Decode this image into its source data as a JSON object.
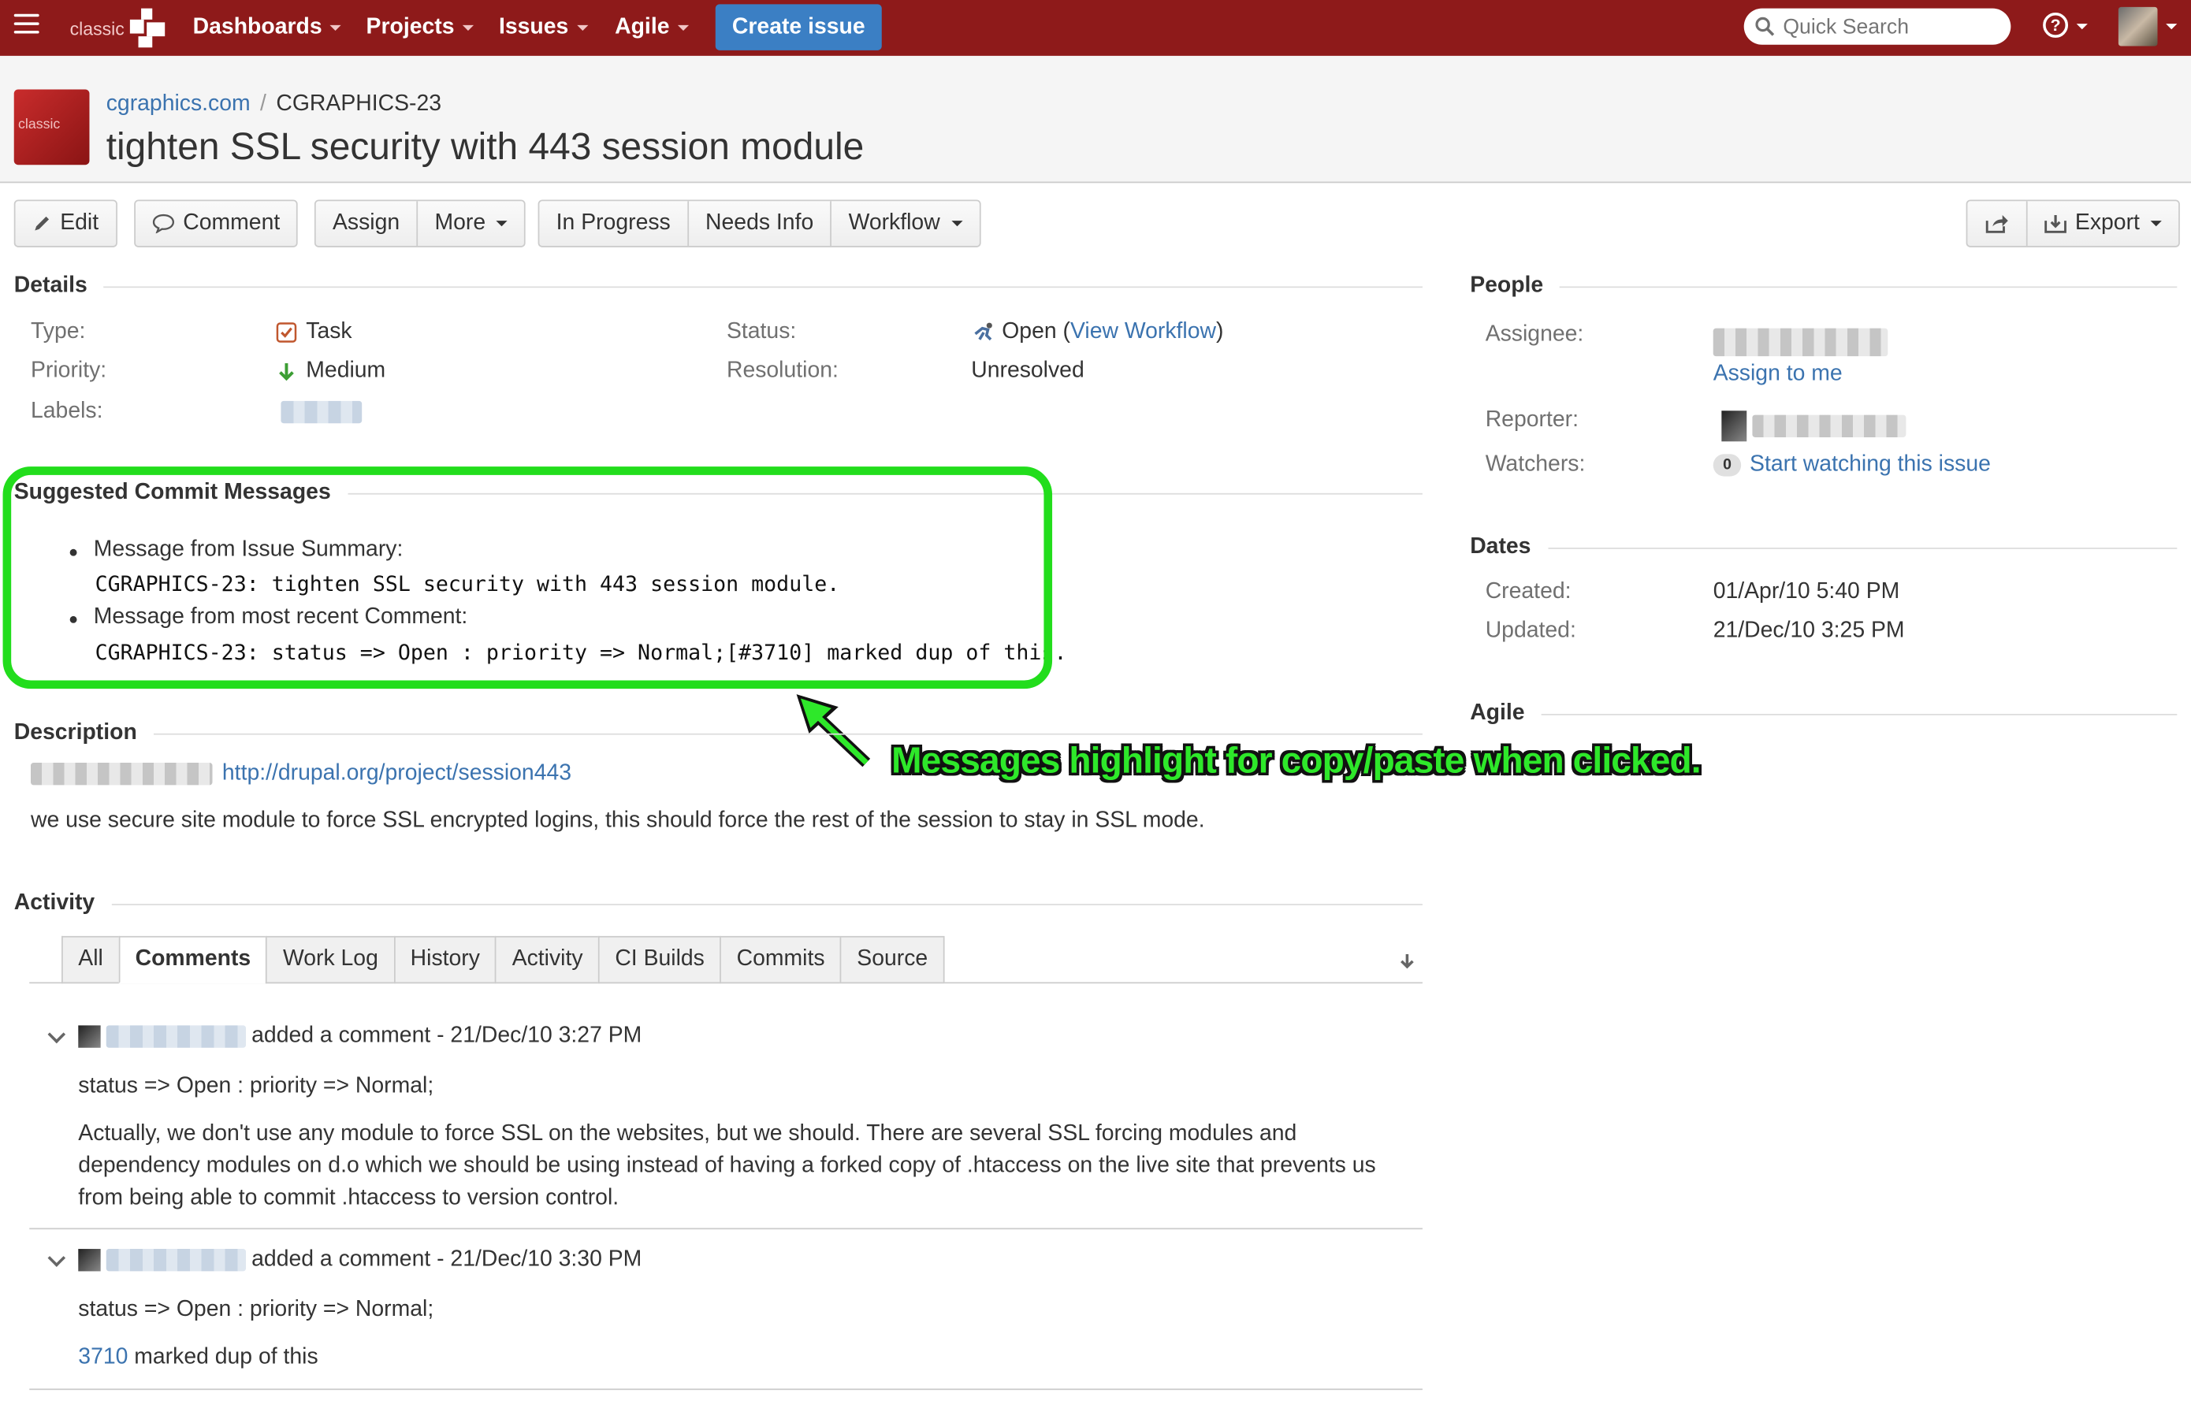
{
  "topbar": {
    "logo_text": "classic",
    "nav": [
      {
        "label": "Dashboards"
      },
      {
        "label": "Projects"
      },
      {
        "label": "Issues"
      },
      {
        "label": "Agile"
      }
    ],
    "create_label": "Create issue",
    "search_placeholder": "Quick Search",
    "help_glyph": "?"
  },
  "header": {
    "project_link": "cgraphics.com",
    "breadcrumb_sep": "/",
    "issue_key": "CGRAPHICS-23",
    "summary": "tighten SSL security with 443 session module",
    "avatar_text": "classic"
  },
  "toolbar": {
    "edit": "Edit",
    "comment": "Comment",
    "assign": "Assign",
    "more": "More",
    "in_progress": "In Progress",
    "needs_info": "Needs Info",
    "workflow": "Workflow",
    "export": "Export"
  },
  "details": {
    "heading": "Details",
    "type_label": "Type:",
    "type_value": "Task",
    "priority_label": "Priority:",
    "priority_value": "Medium",
    "labels_label": "Labels:",
    "status_label": "Status:",
    "status_value": "Open",
    "status_link": "View Workflow",
    "status_paren_open": "(",
    "status_paren_close": ")",
    "resolution_label": "Resolution:",
    "resolution_value": "Unresolved"
  },
  "commit_messages": {
    "heading": "Suggested Commit Messages",
    "items": [
      {
        "label": "Message from Issue Summary:",
        "message": "CGRAPHICS-23: tighten SSL security with 443 session module."
      },
      {
        "label": "Message from most recent Comment:",
        "message": "CGRAPHICS-23: status => Open : priority => Normal;[#3710] marked dup of this."
      }
    ]
  },
  "callout": "Messages highlight for copy/paste when clicked.",
  "description": {
    "heading": "Description",
    "link": "http://drupal.org/project/session443",
    "text": "we use secure site module to force SSL encrypted logins, this should force the rest of the session to stay in SSL mode."
  },
  "activity": {
    "heading": "Activity",
    "tabs": [
      "All",
      "Comments",
      "Work Log",
      "History",
      "Activity",
      "CI Builds",
      "Commits",
      "Source"
    ],
    "active_tab": "Comments",
    "comments": [
      {
        "meta": "added a comment - 21/Dec/10 3:27 PM",
        "line1": "status => Open : priority => Normal;",
        "body": "Actually, we don't use any module to force SSL on the websites, but we should. There are several SSL forcing modules and dependency modules on d.o which we should be using instead of having a forked copy of .htaccess on the live site that prevents us from being able to commit .htaccess to version control."
      },
      {
        "meta": "added a comment - 21/Dec/10 3:30 PM",
        "line1": "status => Open : priority => Normal;",
        "link": "3710",
        "link_suffix": " marked dup of this"
      }
    ]
  },
  "people": {
    "heading": "People",
    "assignee_label": "Assignee:",
    "assign_to_me": "Assign to me",
    "reporter_label": "Reporter:",
    "watchers_label": "Watchers:",
    "watch_count": "0",
    "watch_link": "Start watching this issue"
  },
  "dates": {
    "heading": "Dates",
    "created_label": "Created:",
    "created_value": "01/Apr/10 5:40 PM",
    "updated_label": "Updated:",
    "updated_value": "21/Dec/10 3:25 PM"
  },
  "agile": {
    "heading": "Agile"
  },
  "colors": {
    "topbar": "#8e1a1a",
    "create_button": "#3b7fc4",
    "link": "#3b73af",
    "highlight": "#22dd1c"
  },
  "icons": [
    "menu-icon",
    "search-icon",
    "help-icon",
    "pencil-icon",
    "speech-bubble-icon",
    "share-icon",
    "export-icon",
    "task-icon",
    "arrow-down-icon",
    "open-status-icon",
    "chevron-down-icon",
    "download-arrow-icon"
  ]
}
